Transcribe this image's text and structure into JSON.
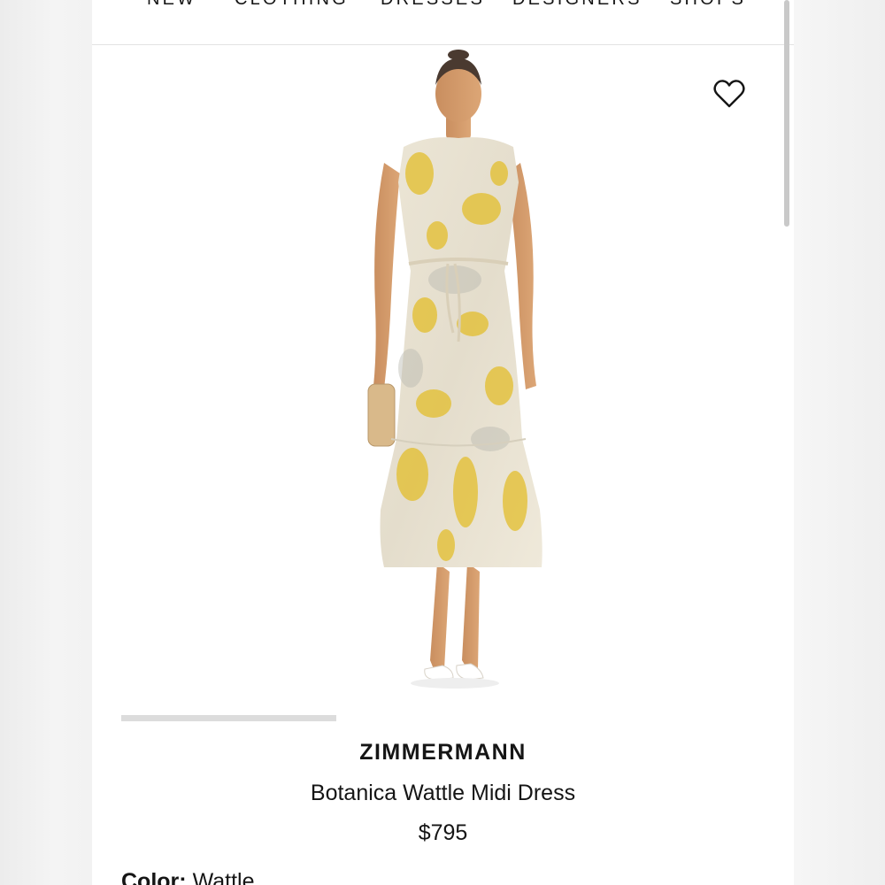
{
  "nav": {
    "items": [
      "NEW",
      "CLOTHING",
      "DRESSES",
      "DESIGNERS",
      "SHOPS"
    ]
  },
  "icons": {
    "wishlist": "heart-outline-icon"
  },
  "product": {
    "brand": "ZIMMERMANN",
    "name": "Botanica Wattle Midi Dress",
    "price": "$795",
    "color_label": "Color:",
    "color_value": "Wattle"
  },
  "colors": {
    "text": "#151515",
    "accent_yellow": "#e3be2c"
  }
}
